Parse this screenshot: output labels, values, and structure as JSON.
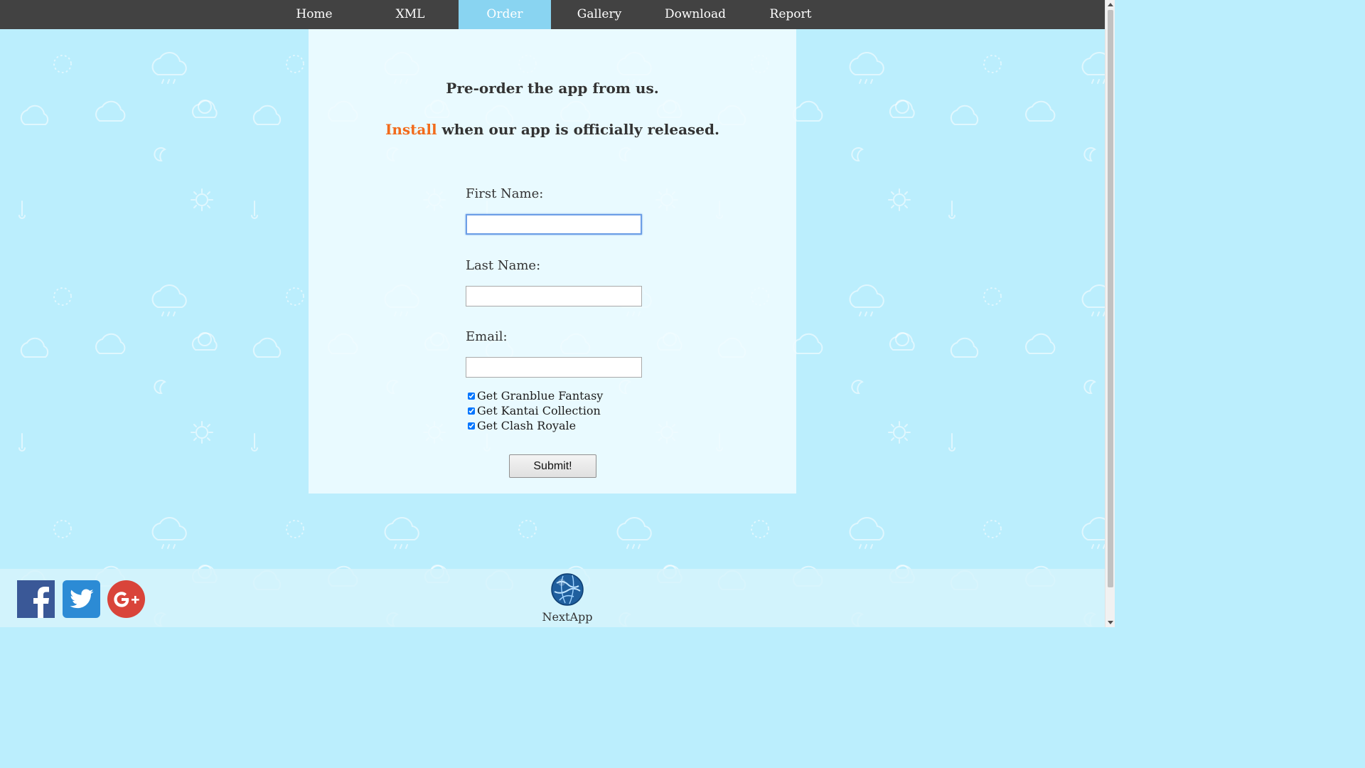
{
  "nav": {
    "items": [
      {
        "label": "Home"
      },
      {
        "label": "XML"
      },
      {
        "label": "Order"
      },
      {
        "label": "Gallery"
      },
      {
        "label": "Download"
      },
      {
        "label": "Report"
      }
    ],
    "active": "Order"
  },
  "hero": {
    "line1": "Pre-order the app from us.",
    "line2_accent": "Install",
    "line2_rest": " when our app is officially released."
  },
  "form": {
    "first_name_label": "First Name:",
    "first_name_value": "",
    "last_name_label": "Last Name:",
    "last_name_value": "",
    "email_label": "Email:",
    "email_value": "",
    "checkboxes": [
      {
        "label": "Get Granblue Fantasy",
        "checked": true
      },
      {
        "label": "Get Kantai Collection",
        "checked": true
      },
      {
        "label": "Get Clash Royale",
        "checked": true
      }
    ],
    "submit_label": "Submit!"
  },
  "footer": {
    "social": [
      {
        "icon": "facebook-icon",
        "color": "#3a5897"
      },
      {
        "icon": "twitter-icon",
        "color": "#2c8bd5"
      },
      {
        "icon": "google-plus-icon",
        "color": "#d9443a"
      }
    ],
    "brand_name": "NextApp"
  },
  "colors": {
    "page_bg": "#bbeefd",
    "nav_bg": "#424242",
    "nav_active": "#89d4f1",
    "accent": "#f26b1c",
    "text": "#333333"
  }
}
